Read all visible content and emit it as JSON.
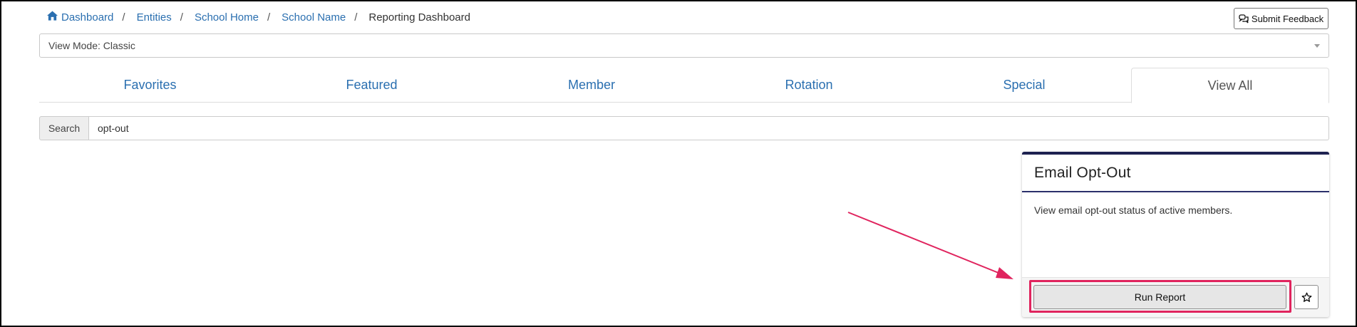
{
  "breadcrumb": {
    "items": [
      "Dashboard",
      "Entities",
      "School Home",
      "School Name"
    ],
    "current": "Reporting Dashboard",
    "separator": "/"
  },
  "feedback": {
    "label": "Submit Feedback"
  },
  "view_mode": {
    "value": "View Mode: Classic"
  },
  "tabs": [
    {
      "label": "Favorites",
      "active": false
    },
    {
      "label": "Featured",
      "active": false
    },
    {
      "label": "Member",
      "active": false
    },
    {
      "label": "Rotation",
      "active": false
    },
    {
      "label": "Special",
      "active": false
    },
    {
      "label": "View All",
      "active": true
    }
  ],
  "search": {
    "label": "Search",
    "value": "opt-out"
  },
  "report_card": {
    "title": "Email Opt-Out",
    "description": "View email opt-out status of active members.",
    "run_label": "Run Report"
  },
  "icons": {
    "home": "home-icon",
    "feedback": "comments-icon",
    "favorite": "star-outline-icon",
    "dropdown": "caret-down-icon"
  },
  "colors": {
    "link": "#2a6fb0",
    "card_accent": "#1e2250",
    "highlight": "#e0245e"
  }
}
